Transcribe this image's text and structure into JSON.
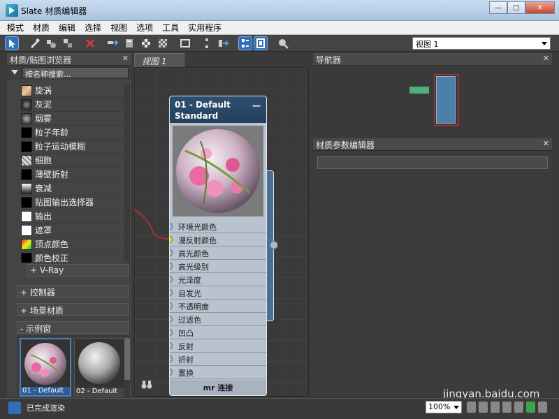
{
  "window": {
    "title": "Slate 材质编辑器"
  },
  "menu": [
    "模式",
    "材质",
    "编辑",
    "选择",
    "视图",
    "选项",
    "工具",
    "实用程序"
  ],
  "toolbar": {
    "view_select": "视图 1"
  },
  "browser": {
    "title": "材质/贴图浏览器",
    "search_placeholder": "按名称搜索...",
    "items": [
      {
        "label": "旋涡"
      },
      {
        "label": "灰泥"
      },
      {
        "label": "烟雾"
      },
      {
        "label": "粒子年龄"
      },
      {
        "label": "粒子运动模糊"
      },
      {
        "label": "细胞"
      },
      {
        "label": "薄壁折射"
      },
      {
        "label": "衰减"
      },
      {
        "label": "贴图输出选择器"
      },
      {
        "label": "输出"
      },
      {
        "label": "遮罩"
      },
      {
        "label": "顶点颜色"
      },
      {
        "label": "颜色校正"
      }
    ],
    "vray_rollout": "+ V-Ray",
    "rollouts": [
      "+ 控制器",
      "+ 场景材质",
      "- 示例窗"
    ],
    "thumbnails": [
      {
        "label": "01 - Default"
      },
      {
        "label": "02 - Default"
      }
    ]
  },
  "view": {
    "tab": "视图 1"
  },
  "node": {
    "title": "01 - Default",
    "subtitle": "Standard",
    "slots": [
      {
        "label": "环境光颜色",
        "connected": false
      },
      {
        "label": "漫反射颜色",
        "connected": true
      },
      {
        "label": "高光颜色",
        "connected": false
      },
      {
        "label": "高光级别",
        "connected": false
      },
      {
        "label": "光泽度",
        "connected": false
      },
      {
        "label": "自发光",
        "connected": false
      },
      {
        "label": "不透明度",
        "connected": false
      },
      {
        "label": "过滤色",
        "connected": false
      },
      {
        "label": "凹凸",
        "connected": false
      },
      {
        "label": "反射",
        "connected": false
      },
      {
        "label": "折射",
        "connected": false
      },
      {
        "label": "置换",
        "connected": false
      }
    ],
    "footer": "mr 连接"
  },
  "navigator": {
    "title": "导航器"
  },
  "param_editor": {
    "title": "材质参数编辑器"
  },
  "status": {
    "text": "已完成渲染",
    "zoom": "100%"
  },
  "watermark": "jingyan.baidu.com",
  "colors": {
    "accent": "#2f6fb8",
    "node_header": "#2f4f70",
    "connected_slot": "#c7f400",
    "wire": "#d12b2b"
  }
}
